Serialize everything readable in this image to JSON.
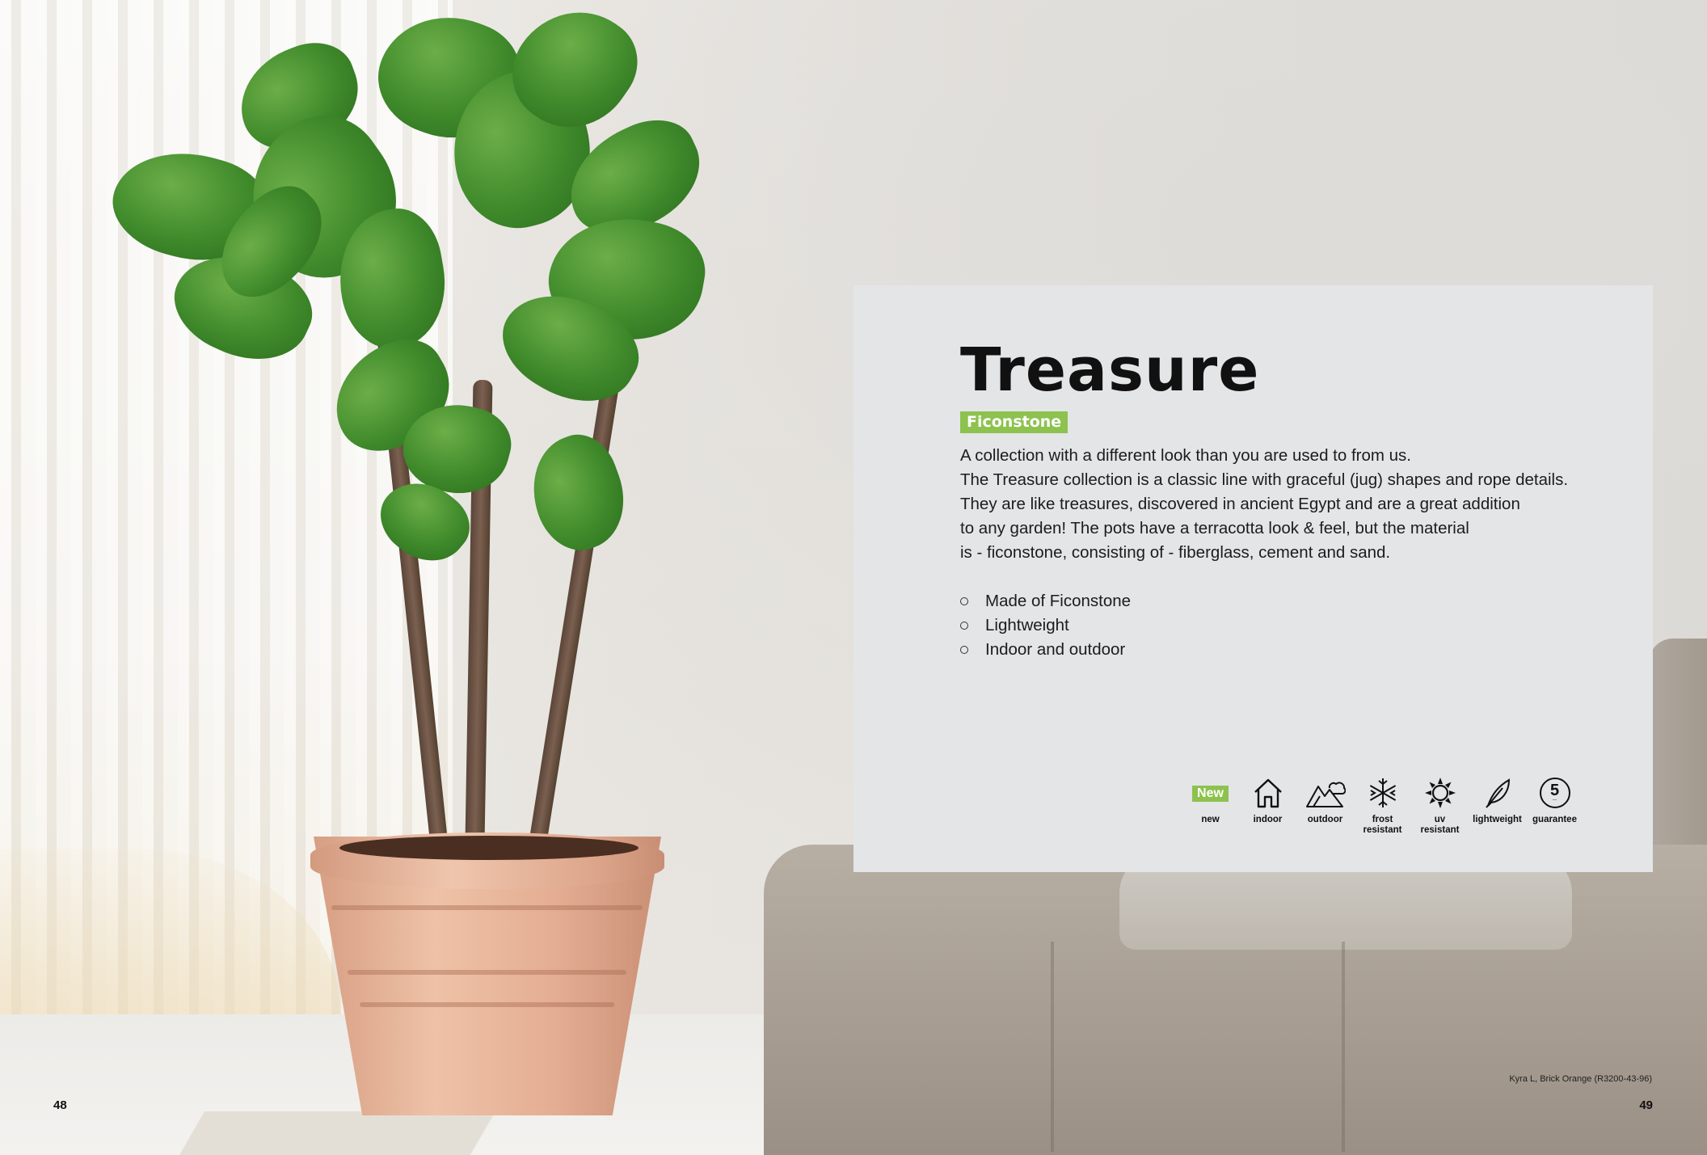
{
  "product": {
    "title": "Treasure",
    "material_tag": "Ficonstone",
    "description_lines": [
      "A collection with a different look than you are used to from us.",
      "The Treasure collection is a classic line with graceful (jug) shapes and rope details.",
      "They are like treasures, discovered in ancient Egypt and are a great addition",
      "to any garden! The pots have a terracotta look & feel, but the material",
      "is - ficonstone, consisting of - fiberglass, cement and sand."
    ],
    "bullets": [
      "Made of Ficonstone",
      "Lightweight",
      "Indoor and outdoor"
    ]
  },
  "features": [
    {
      "icon": "new-badge",
      "badge": "New",
      "label": "new"
    },
    {
      "icon": "house-icon",
      "label": "indoor"
    },
    {
      "icon": "mountain-cloud-icon",
      "label": "outdoor"
    },
    {
      "icon": "snowflake-icon",
      "label": "frost\nresistant"
    },
    {
      "icon": "sun-icon",
      "label": "uv\nresistant"
    },
    {
      "icon": "feather-icon",
      "label": "lightweight"
    },
    {
      "icon": "guarantee-icon",
      "number": "5",
      "label": "guarantee"
    }
  ],
  "page_left": "48",
  "page_right": "49",
  "photo_caption": "Kyra L, Brick Orange (R3200-43-96)",
  "colors": {
    "accent_green": "#8dc24f",
    "card_bg": "#e4e5e6"
  }
}
